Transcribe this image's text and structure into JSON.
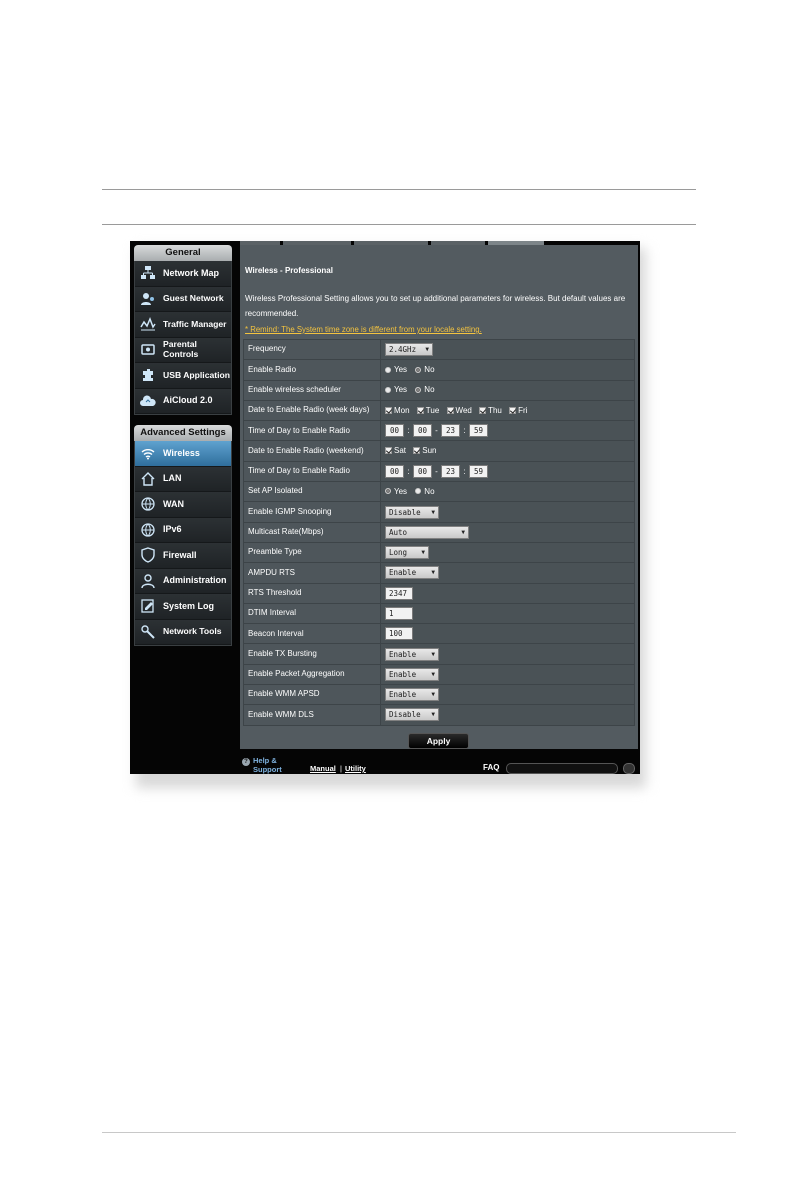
{
  "sidebar": {
    "general_header": "General",
    "general_items": [
      {
        "label": "Network Map",
        "icon": "network-map-icon"
      },
      {
        "label": "Guest Network",
        "icon": "guest-network-icon"
      },
      {
        "label": "Traffic Manager",
        "icon": "traffic-manager-icon"
      },
      {
        "label": "Parental Controls",
        "icon": "parental-controls-icon"
      },
      {
        "label": "USB Application",
        "icon": "usb-application-icon"
      },
      {
        "label": "AiCloud 2.0",
        "icon": "aicloud-icon"
      }
    ],
    "advanced_header": "Advanced Settings",
    "advanced_items": [
      {
        "label": "Wireless",
        "icon": "wifi-icon",
        "active": true
      },
      {
        "label": "LAN",
        "icon": "home-icon"
      },
      {
        "label": "WAN",
        "icon": "globe-icon"
      },
      {
        "label": "IPv6",
        "icon": "globe-icon"
      },
      {
        "label": "Firewall",
        "icon": "shield-icon"
      },
      {
        "label": "Administration",
        "icon": "user-icon"
      },
      {
        "label": "System Log",
        "icon": "log-icon"
      },
      {
        "label": "Network Tools",
        "icon": "tools-icon"
      }
    ]
  },
  "main": {
    "section_title": "Wireless - Professional",
    "description": "Wireless Professional Setting allows you to set up additional parameters for wireless. But default values are recommended.",
    "remind": "* Remind: The System time zone is different from your locale setting.",
    "settings": {
      "frequency": {
        "label": "Frequency",
        "value": "2.4GHz"
      },
      "enable_radio": {
        "label": "Enable Radio",
        "yes": "Yes",
        "no": "No"
      },
      "enable_scheduler": {
        "label": "Enable wireless scheduler",
        "yes": "Yes",
        "no": "No"
      },
      "date_weekdays": {
        "label": "Date to Enable Radio (week days)",
        "days": [
          "Mon",
          "Tue",
          "Wed",
          "Thu",
          "Fri"
        ]
      },
      "time_weekdays": {
        "label": "Time of Day to Enable Radio",
        "start_h": "00",
        "start_m": "00",
        "end_h": "23",
        "end_m": "59"
      },
      "date_weekend": {
        "label": "Date to Enable Radio (weekend)",
        "days": [
          "Sat",
          "Sun"
        ]
      },
      "time_weekend": {
        "label": "Time of Day to Enable Radio",
        "start_h": "00",
        "start_m": "00",
        "end_h": "23",
        "end_m": "59"
      },
      "ap_isolated": {
        "label": "Set AP Isolated",
        "yes": "Yes",
        "no": "No"
      },
      "igmp_snooping": {
        "label": "Enable IGMP Snooping",
        "value": "Disable"
      },
      "multicast_rate": {
        "label": "Multicast Rate(Mbps)",
        "value": "Auto"
      },
      "preamble_type": {
        "label": "Preamble Type",
        "value": "Long"
      },
      "ampdu_rts": {
        "label": "AMPDU RTS",
        "value": "Enable"
      },
      "rts_threshold": {
        "label": "RTS Threshold",
        "value": "2347"
      },
      "dtim_interval": {
        "label": "DTIM Interval",
        "value": "1"
      },
      "beacon_interval": {
        "label": "Beacon Interval",
        "value": "100"
      },
      "tx_bursting": {
        "label": "Enable TX Bursting",
        "value": "Enable"
      },
      "packet_aggregation": {
        "label": "Enable Packet Aggregation",
        "value": "Enable"
      },
      "wmm_apsd": {
        "label": "Enable WMM APSD",
        "value": "Enable"
      },
      "wmm_dls": {
        "label": "Enable WMM DLS",
        "value": "Disable"
      }
    },
    "apply_label": "Apply"
  },
  "footer": {
    "help_label": "Help & Support",
    "manual_label": "Manual",
    "separator": "|",
    "utility_label": "Utility",
    "faq_label": "FAQ"
  }
}
